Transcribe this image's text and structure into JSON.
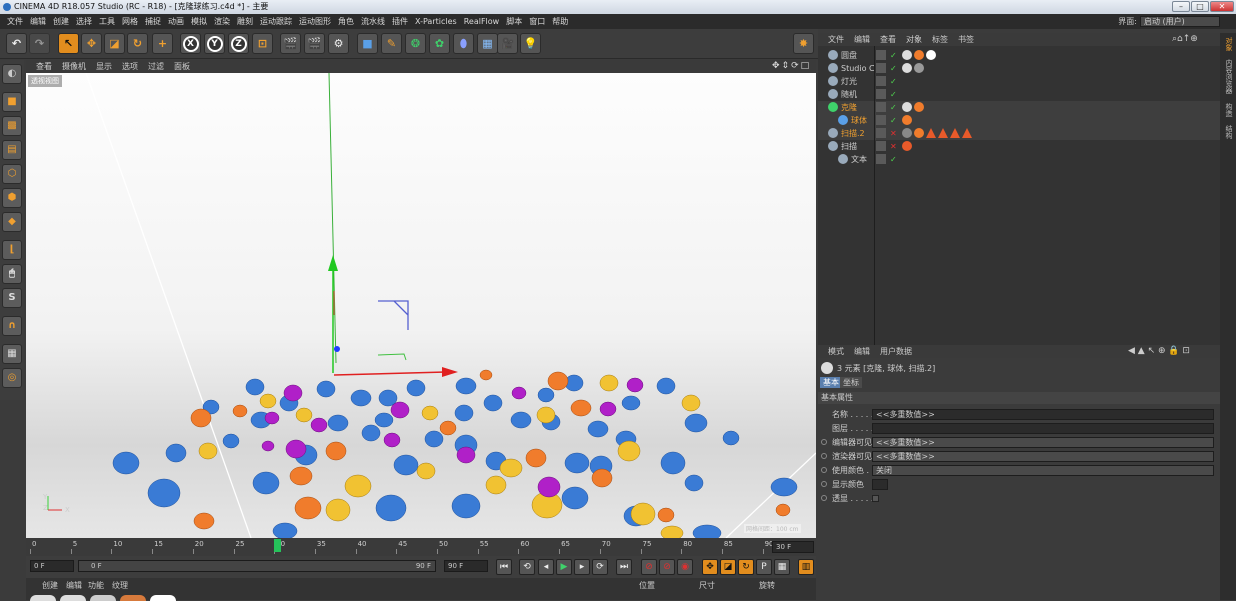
{
  "window": {
    "title": "CINEMA 4D R18.057 Studio (RC - R18) - [克隆球练习.c4d *] - 主要"
  },
  "menu": [
    "文件",
    "编辑",
    "创建",
    "选择",
    "工具",
    "网格",
    "捕捉",
    "动画",
    "模拟",
    "渲染",
    "雕刻",
    "运动跟踪",
    "运动图形",
    "角色",
    "流水线",
    "插件",
    "X-Particles",
    "RealFlow",
    "脚本",
    "窗口",
    "帮助"
  ],
  "interface": {
    "label": "界面:",
    "value": "启动 (用户)"
  },
  "viewport": {
    "menu": [
      "查看",
      "摄像机",
      "显示",
      "选项",
      "过滤",
      "面板"
    ],
    "view_label": "透视视图",
    "grid_label": "网格间距：100 cm",
    "axis_labels": [
      "Z",
      "Y",
      "X"
    ]
  },
  "timeline": {
    "ticks": [
      "0",
      "5",
      "10",
      "15",
      "20",
      "25",
      "30",
      "35",
      "40",
      "45",
      "50",
      "55",
      "60",
      "65",
      "70",
      "75",
      "80",
      "85",
      "90"
    ],
    "current_frame": "30",
    "frame_display": "30 F"
  },
  "playback": {
    "start": "0 F",
    "range_start": "0 F",
    "range_end": "90 F",
    "end": "90 F"
  },
  "bottom_panel": {
    "menu": [
      "创建",
      "编辑",
      "功能",
      "纹理"
    ]
  },
  "coord_panel": {
    "headers": [
      "位置",
      "尺寸",
      "旋转"
    ]
  },
  "object_manager": {
    "menu": [
      "文件",
      "编辑",
      "查看",
      "对象",
      "标签",
      "书签"
    ],
    "objects": [
      {
        "name": "圆盘",
        "level": 0,
        "color": "#cfcfcf"
      },
      {
        "name": "Studio C",
        "level": 0,
        "color": "#cfcfcf"
      },
      {
        "name": "灯光",
        "level": 0,
        "color": "#cfcfcf"
      },
      {
        "name": "随机",
        "level": 0,
        "color": "#cfcfcf"
      },
      {
        "name": "克隆",
        "level": 0,
        "color": "#f0a030"
      },
      {
        "name": "球体",
        "level": 1,
        "color": "#f0a030"
      },
      {
        "name": "扫描.2",
        "level": 0,
        "color": "#f0a030"
      },
      {
        "name": "扫描",
        "level": 0,
        "color": "#cfcfcf"
      },
      {
        "name": "文本",
        "level": 1,
        "color": "#cfcfcf"
      }
    ]
  },
  "attribute_manager": {
    "menu": [
      "模式",
      "编辑",
      "用户数据"
    ],
    "selection": "3 元素 [克隆, 球体, 扫描.2]",
    "tabs": [
      "基本",
      "坐标"
    ],
    "section": "基本属性",
    "fields": [
      {
        "label": "名称 . . . . . .",
        "value": "<<多重数值>>"
      },
      {
        "label": "图层 . . . . . .",
        "value": ""
      },
      {
        "label": "编辑器可见",
        "value": "<<多重数值>>"
      },
      {
        "label": "渲染器可见",
        "value": "<<多重数值>>"
      },
      {
        "label": "使用颜色 . . .",
        "value": "关闭"
      },
      {
        "label": "显示颜色",
        "value": ""
      },
      {
        "label": "透显 . . . . . .",
        "value": ""
      }
    ]
  },
  "side_tabs": [
    "对象",
    "内容浏览器",
    "构造",
    "结构"
  ],
  "colors": {
    "accent": "#e28d1e",
    "playhead": "#25c25a",
    "sphere_blue": "#3a7bd5",
    "sphere_yellow": "#f1c232",
    "sphere_orange": "#f07c2c",
    "sphere_magenta": "#b020c8"
  }
}
